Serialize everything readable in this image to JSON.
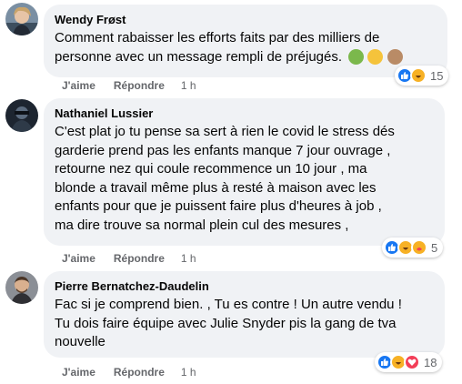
{
  "comments": [
    {
      "author": "Wendy Frøst",
      "lines": [
        "Comment rabaisser les efforts faits par des milliers de",
        "personne avec un message rempli de préjugés."
      ],
      "inline_emojis": [
        "nauseated-face-icon",
        "scream-face-icon",
        "facepalm-person-icon"
      ],
      "like_label": "J'aime",
      "reply_label": "Répondre",
      "time": "1 h",
      "reactions": [
        "like-reaction-icon",
        "haha-reaction-icon"
      ],
      "reaction_count": "15"
    },
    {
      "author": "Nathaniel Lussier",
      "lines": [
        "C'est plat jo tu pense sa sert à rien le covid le stress dés",
        "garderie prend pas les enfants manque 7 jour ouvrage ,",
        "retourne nez qui coule recommence un 10 jour , ma",
        "blonde a travail même plus à resté à maison avec les",
        "enfants pour que je puissent faire plus d'heures à job ,",
        "ma dire trouve sa normal plein cul des mesures ,"
      ],
      "like_label": "J'aime",
      "reply_label": "Répondre",
      "time": "1 h",
      "reactions": [
        "like-reaction-icon",
        "haha-reaction-icon",
        "care-reaction-icon"
      ],
      "reaction_count": "5"
    },
    {
      "author": "Pierre Bernatchez-Daudelin",
      "lines": [
        "Fac si je comprend bien. , Tu es contre ! Un autre vendu !",
        "Tu dois faire équipe avec Julie Snyder pis la gang de tva",
        "nouvelle"
      ],
      "like_label": "J'aime",
      "reply_label": "Répondre",
      "time": "1 h",
      "reactions": [
        "like-reaction-icon",
        "haha-reaction-icon",
        "love-reaction-icon"
      ],
      "reaction_count": "18"
    }
  ],
  "colors": {
    "bubble": "#f0f2f5",
    "meta_text": "#65676b",
    "like_blue": "#1877f2",
    "haha_yellow": "#f7b125",
    "love_red": "#f33e58"
  }
}
